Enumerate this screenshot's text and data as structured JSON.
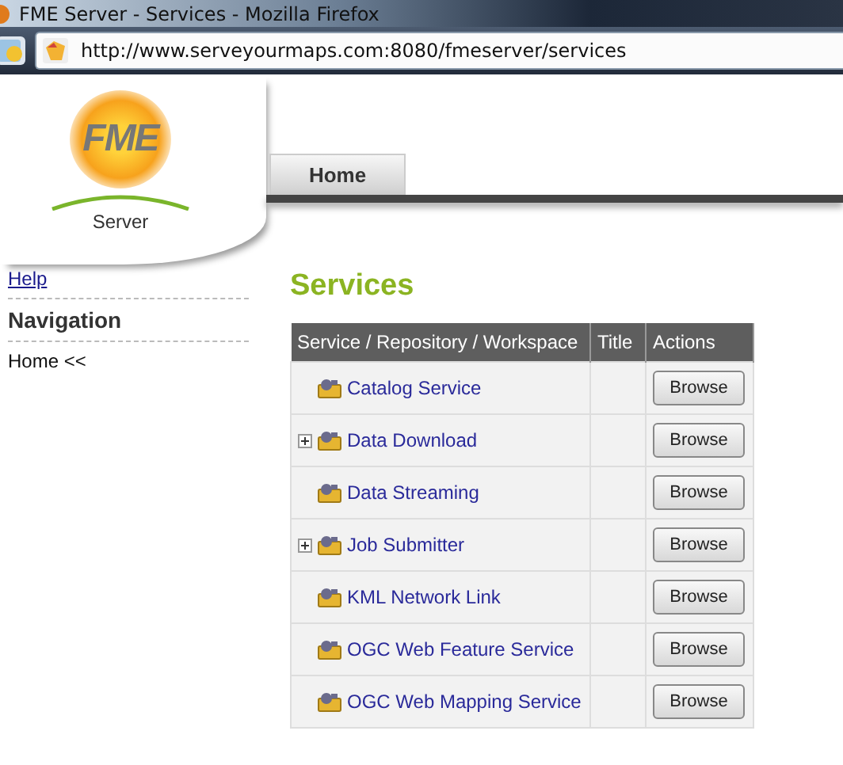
{
  "window": {
    "title": "FME Server - Services - Mozilla Firefox"
  },
  "address_bar": {
    "url": "http://www.serveyourmaps.com:8080/fmeserver/services"
  },
  "logo": {
    "wordmark": "FME",
    "product": "Server"
  },
  "tabs": [
    {
      "label": "Home",
      "selected": true
    }
  ],
  "sidebar": {
    "help_link": "Help",
    "heading": "Navigation",
    "items": [
      "Home <<"
    ]
  },
  "page_title": "Services",
  "table": {
    "columns": [
      "Service / Repository / Workspace",
      "Title",
      "Actions"
    ],
    "rows": [
      {
        "name": "Catalog Service",
        "expandable": false,
        "action": "Browse"
      },
      {
        "name": "Data Download",
        "expandable": true,
        "action": "Browse"
      },
      {
        "name": "Data Streaming",
        "expandable": false,
        "action": "Browse"
      },
      {
        "name": "Job Submitter",
        "expandable": true,
        "action": "Browse"
      },
      {
        "name": "KML Network Link",
        "expandable": false,
        "action": "Browse"
      },
      {
        "name": "OGC Web Feature Service",
        "expandable": false,
        "action": "Browse"
      },
      {
        "name": "OGC Web Mapping Service",
        "expandable": false,
        "action": "Browse"
      }
    ]
  }
}
